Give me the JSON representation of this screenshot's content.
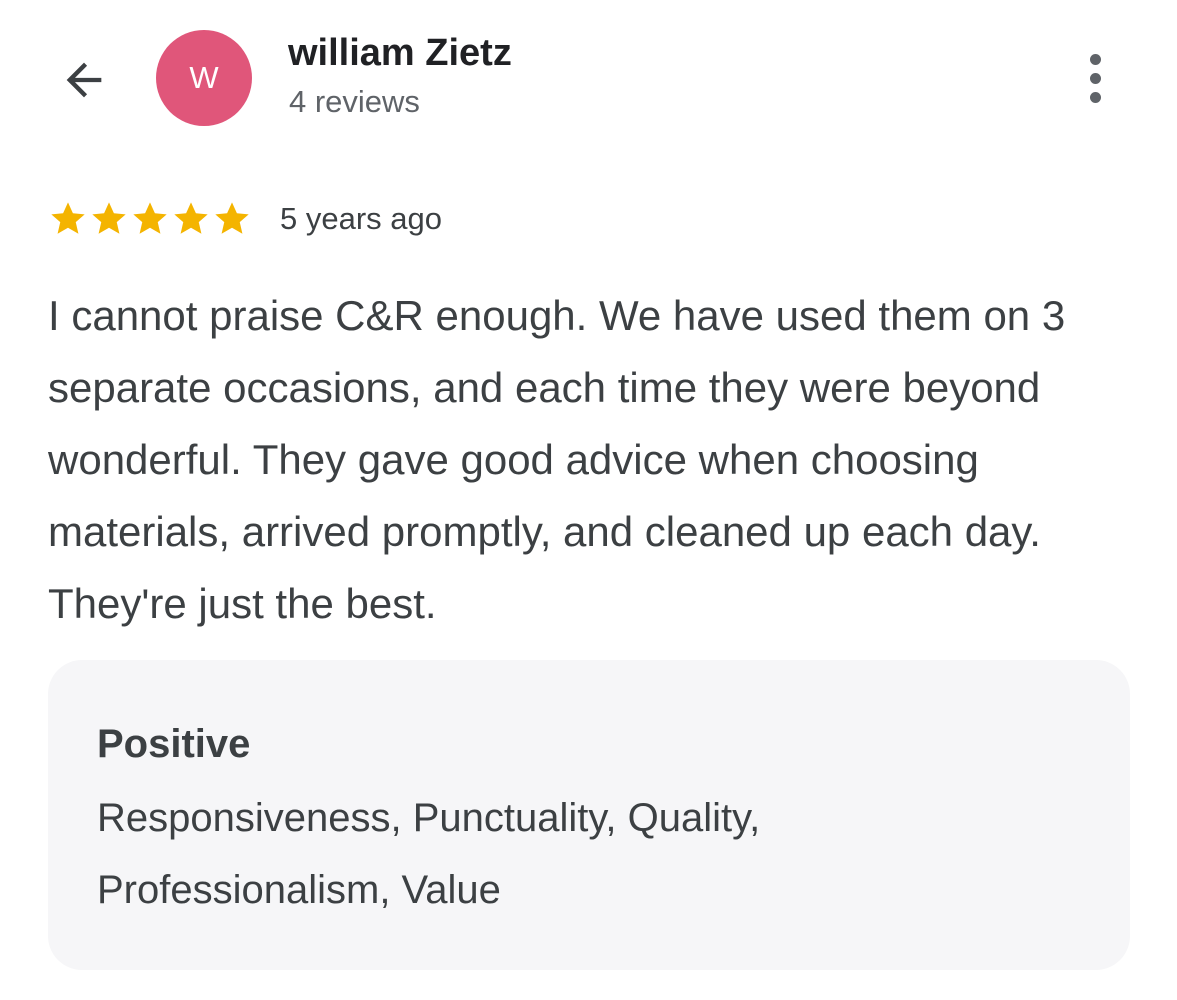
{
  "header": {
    "back_icon": "arrow-left-icon",
    "avatar_initial": "W",
    "avatar_color": "#e0567a",
    "author_name": "william Zietz",
    "review_count": "4 reviews",
    "more_icon": "more-vertical-icon"
  },
  "review": {
    "rating": 5,
    "rating_max": 5,
    "star_color": "#f4b400",
    "date": "5 years ago",
    "text": "I cannot praise C&R enough. We have used them on 3 separate occasions, and each time they were beyond wonderful. They gave good advice when choosing materials, arrived promptly, and cleaned up each day. They're just the best."
  },
  "attributes": {
    "heading": "Positive",
    "values": "Responsiveness, Punctuality, Quality, Professionalism, Value"
  }
}
